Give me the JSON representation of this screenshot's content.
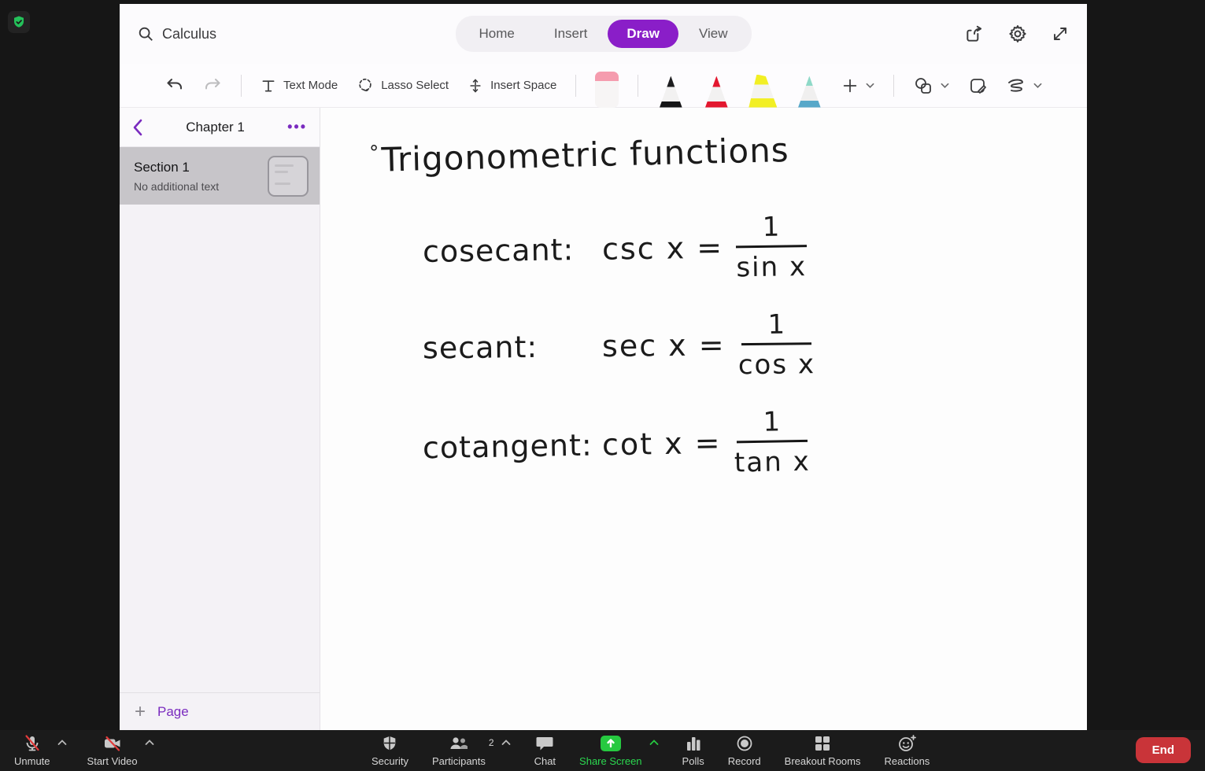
{
  "badge": {
    "icon": "shield-check-icon"
  },
  "app": {
    "search": {
      "icon": "search-icon",
      "value": "Calculus"
    },
    "tabs": [
      {
        "label": "Home"
      },
      {
        "label": "Insert"
      },
      {
        "label": "Draw",
        "active": true
      },
      {
        "label": "View"
      }
    ],
    "window_icons": [
      "share-icon",
      "settings-gear-icon",
      "expand-icon"
    ],
    "toolbar": {
      "undo": "undo-icon",
      "redo": "redo-icon",
      "text_mode_label": "Text Mode",
      "lasso_label": "Lasso Select",
      "insert_space_label": "Insert Space",
      "pens": [
        {
          "name": "eraser",
          "color": "#f59cae"
        },
        {
          "name": "black-pen",
          "color": "#1d1d1f"
        },
        {
          "name": "red-pen",
          "color": "#e3172f"
        },
        {
          "name": "yellow-highlighter",
          "color": "#f2ef24"
        },
        {
          "name": "teal-pen",
          "color": "#8fd9c8"
        }
      ],
      "add_label": "+",
      "right_icons": [
        "shapes-icon",
        "note-pen-icon",
        "ink-squiggle-icon"
      ]
    },
    "sidebar": {
      "back_icon": "chevron-left-icon",
      "title": "Chapter 1",
      "more": "•••",
      "sections": [
        {
          "title": "Section 1",
          "subtitle": "No additional text",
          "selected": true
        }
      ],
      "add_page": {
        "plus": "+",
        "label": "Page"
      }
    },
    "notes": {
      "bullet": "°",
      "title": "Trigonometric functions",
      "formulas": [
        {
          "name": "cosecant:",
          "lhs": "csc x =",
          "numerator": "1",
          "denominator": "sin x"
        },
        {
          "name": "secant:",
          "lhs": "sec x =",
          "numerator": "1",
          "denominator": "cos x"
        },
        {
          "name": "cotangent:",
          "lhs": "cot x =",
          "numerator": "1",
          "denominator": "tan x"
        }
      ]
    }
  },
  "zoom_toolbar": {
    "unmute": "Unmute",
    "start_video": "Start Video",
    "security": "Security",
    "participants": "Participants",
    "participants_count": "2",
    "chat": "Chat",
    "share_screen": "Share Screen",
    "polls": "Polls",
    "record": "Record",
    "breakout_rooms": "Breakout Rooms",
    "reactions": "Reactions",
    "end": "End"
  },
  "colors": {
    "accent_purple": "#8a1ec8",
    "sidebar_purple": "#7a2bbf",
    "share_green": "#26c940",
    "end_red": "#c93439",
    "slash_red": "#e23b3b",
    "badge_green": "#24c15a"
  }
}
